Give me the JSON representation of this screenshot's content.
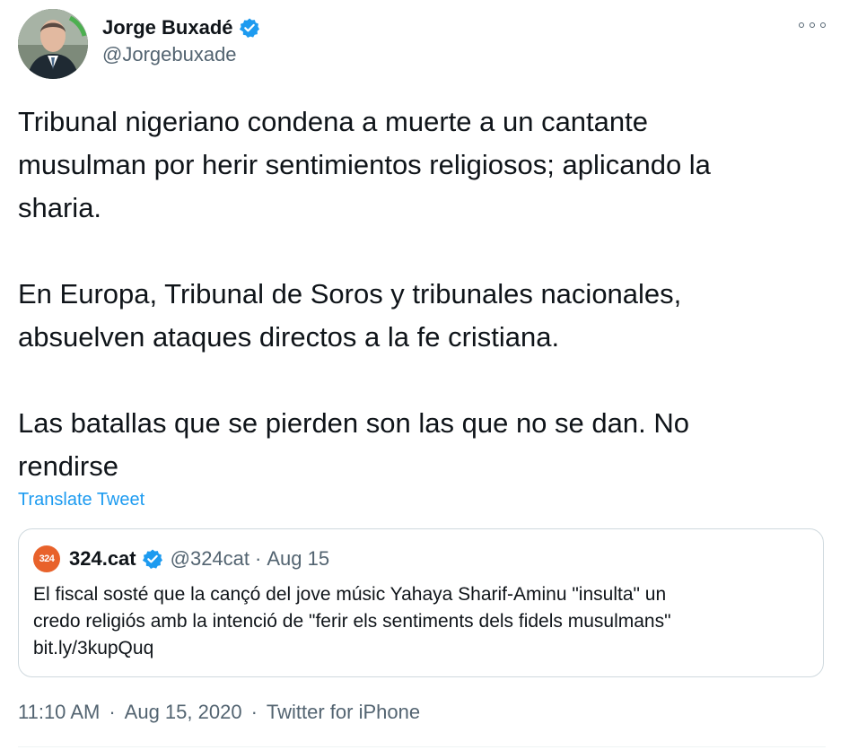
{
  "author": {
    "name": "Jorge Buxadé",
    "handle": "@Jorgebuxade",
    "verified": true
  },
  "tweet": {
    "paragraphs": [
      [
        "Tribunal nigeriano condena a muerte a un cantante",
        "musulman por herir sentimientos religiosos; aplicando la",
        "sharia."
      ],
      [
        "En Europa, Tribunal de Soros y tribunales nacionales,",
        "absuelven ataques directos a la fe cristiana."
      ],
      [
        "Las batallas que se pierden son las que no se dan. No",
        "rendirse"
      ]
    ],
    "translate_label": "Translate Tweet"
  },
  "quoted": {
    "avatar_text": "324",
    "name": "324.cat",
    "handle": "@324cat",
    "separator": "·",
    "date": "Aug 15",
    "text_lines": [
      "El fiscal sosté que la cançó del jove músic Yahaya Sharif-Aminu \"insulta\" un",
      "credo religiós amb la intenció de \"ferir els sentiments dels fidels musulmans\"",
      "bit.ly/3kupQuq"
    ]
  },
  "meta": {
    "time": "11:10 AM",
    "date": "Aug 15, 2020",
    "source": "Twitter for iPhone",
    "separator": "·"
  },
  "icons": {
    "verified": "verified-badge-icon",
    "more": "more-options-icon"
  },
  "colors": {
    "accent": "#1d9bf0",
    "text": "#0f1419",
    "secondary": "#536471",
    "border": "#cfd9de",
    "quote_avatar": "#e8622b"
  }
}
